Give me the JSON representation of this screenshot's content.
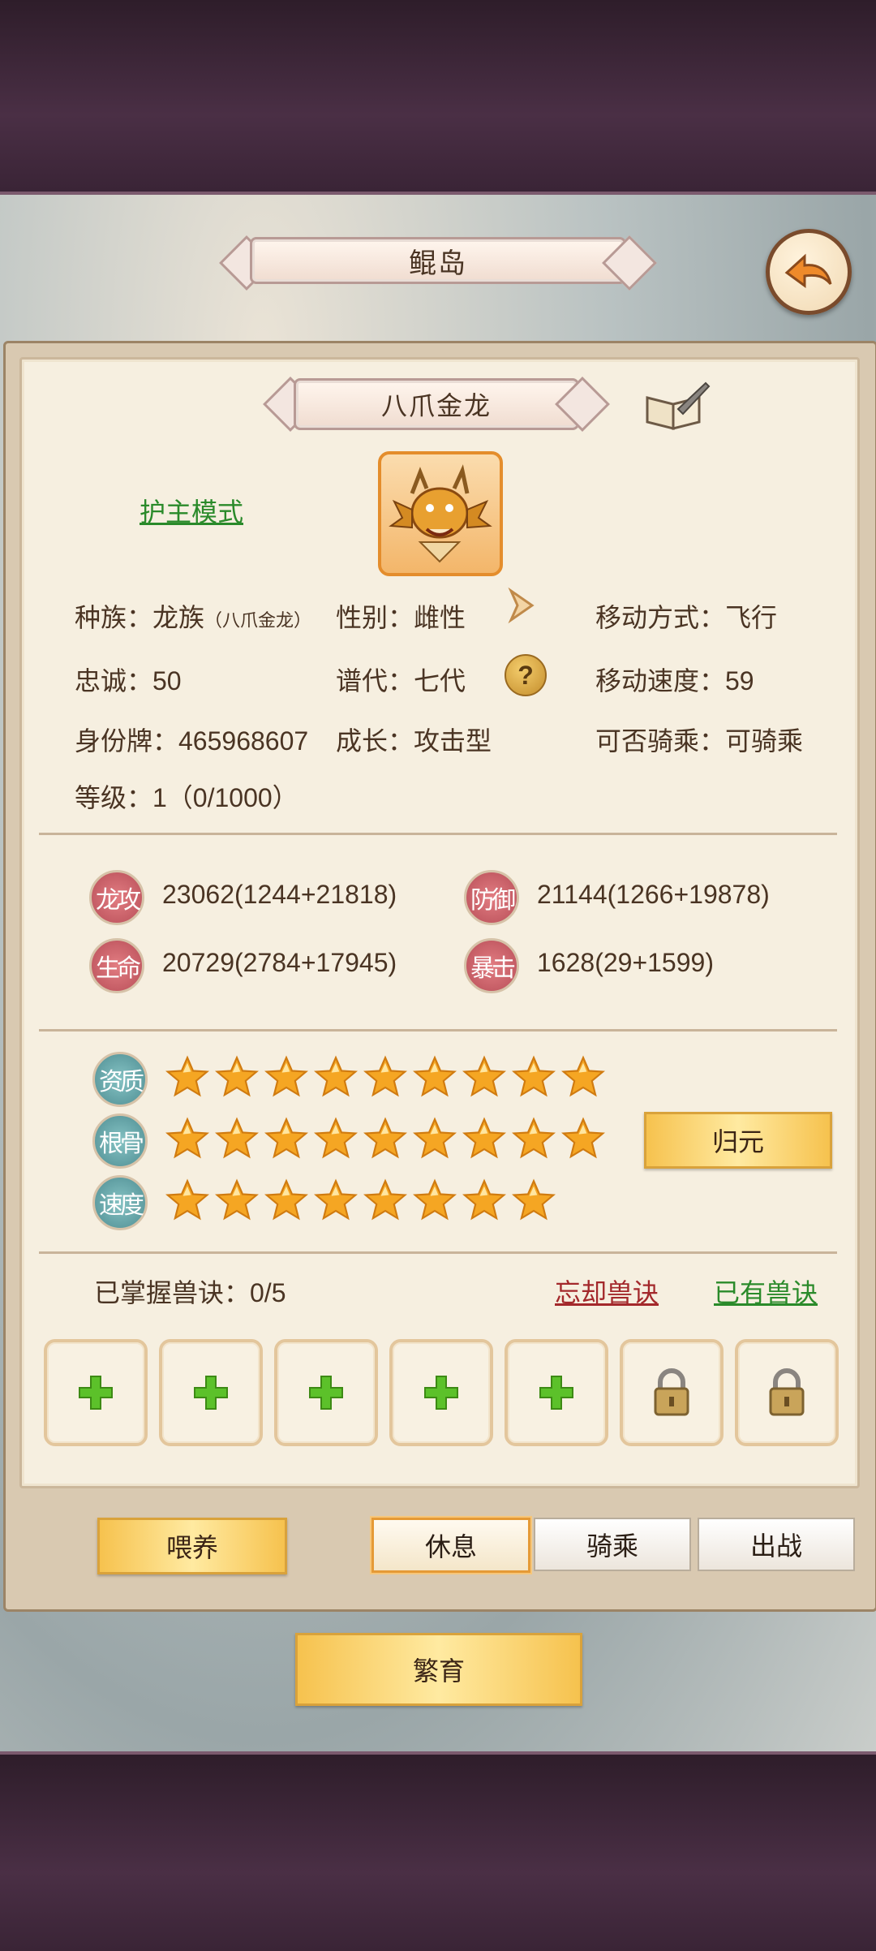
{
  "header": {
    "location_title": "鲲岛"
  },
  "pet": {
    "name": "八爪金龙",
    "mode_link": "护主模式",
    "info": {
      "race_label": "种族：龙族",
      "race_sub": "（八爪金龙）",
      "gender": "性别：雌性",
      "move_mode": "移动方式：飞行",
      "loyalty": "忠诚：50",
      "generation": "谱代：七代",
      "move_speed": "移动速度：59",
      "id_tag": "身份牌：465968607",
      "growth": "成长：攻击型",
      "rideable": "可否骑乘：可骑乘",
      "level": "等级：1（0/1000）"
    },
    "stats": [
      {
        "badge": "龙攻",
        "value": "23062(1244+21818)"
      },
      {
        "badge": "防御",
        "value": "21144(1266+19878)"
      },
      {
        "badge": "生命",
        "value": "20729(2784+17945)"
      },
      {
        "badge": "暴击",
        "value": "1628(29+1599)"
      }
    ],
    "aptitudes": [
      {
        "badge": "资质",
        "stars": 9
      },
      {
        "badge": "根骨",
        "stars": 9
      },
      {
        "badge": "速度",
        "stars": 8
      }
    ],
    "reset_button": "归元"
  },
  "skills": {
    "label": "已掌握兽诀：0/5",
    "forget_link": "忘却兽诀",
    "owned_link": "已有兽诀",
    "slots": [
      "add",
      "add",
      "add",
      "add",
      "add",
      "locked",
      "locked"
    ]
  },
  "actions": {
    "feed": "喂养",
    "rest": "休息",
    "ride": "骑乘",
    "battle": "出战",
    "breed": "繁育"
  },
  "colors": {
    "gold": "#f6c24e",
    "link_green": "#2a8a2a",
    "link_red": "#a3282b",
    "star": "#f5a623"
  }
}
